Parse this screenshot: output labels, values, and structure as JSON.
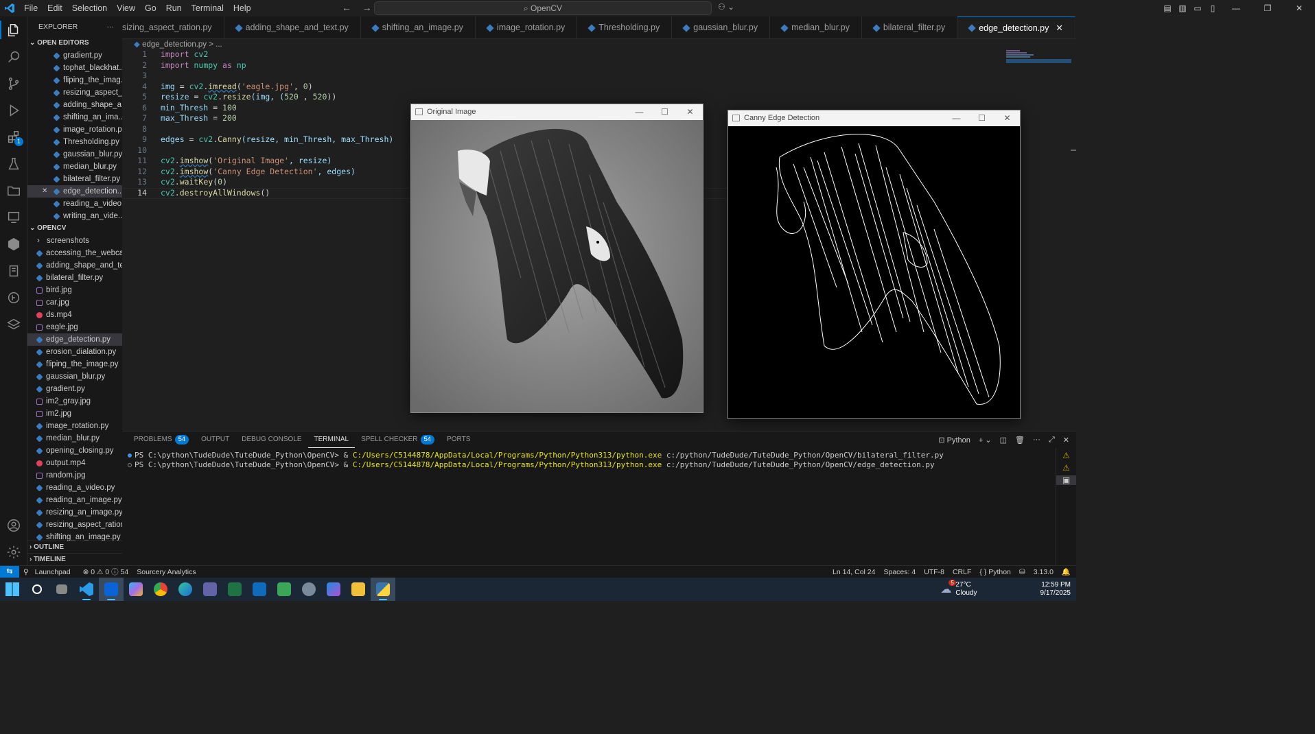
{
  "menu": [
    "File",
    "Edit",
    "Selection",
    "View",
    "Go",
    "Run",
    "Terminal",
    "Help"
  ],
  "search": "OpenCV",
  "explorer": {
    "title": "EXPLORER",
    "open_editors": "OPEN EDITORS",
    "folder": "OPENCV",
    "outline": "OUTLINE",
    "timeline": "TIMELINE",
    "badge": "1"
  },
  "open_editors": [
    "gradient.py",
    "tophat_blackhat...",
    "fliping_the_imag...",
    "resizing_aspect_...",
    "adding_shape_a...",
    "shifting_an_ima...",
    "image_rotation.py",
    "Thresholding.py",
    "gaussian_blur.py",
    "median_blur.py",
    "bilateral_filter.py",
    "edge_detection....",
    "reading_a_video...",
    "writing_an_vide..."
  ],
  "files": [
    {
      "name": "screenshots",
      "type": "folder"
    },
    {
      "name": "accessing_the_webca...",
      "type": "py"
    },
    {
      "name": "adding_shape_and_te...",
      "type": "py"
    },
    {
      "name": "bilateral_filter.py",
      "type": "py"
    },
    {
      "name": "bird.jpg",
      "type": "img"
    },
    {
      "name": "car.jpg",
      "type": "img"
    },
    {
      "name": "ds.mp4",
      "type": "mp4"
    },
    {
      "name": "eagle.jpg",
      "type": "img"
    },
    {
      "name": "edge_detection.py",
      "type": "py"
    },
    {
      "name": "erosion_dialation.py",
      "type": "py"
    },
    {
      "name": "fliping_the_image.py",
      "type": "py"
    },
    {
      "name": "gaussian_blur.py",
      "type": "py"
    },
    {
      "name": "gradient.py",
      "type": "py"
    },
    {
      "name": "im2_gray.jpg",
      "type": "img"
    },
    {
      "name": "im2.jpg",
      "type": "img"
    },
    {
      "name": "image_rotation.py",
      "type": "py"
    },
    {
      "name": "median_blur.py",
      "type": "py"
    },
    {
      "name": "opening_closing.py",
      "type": "py"
    },
    {
      "name": "output.mp4",
      "type": "mp4"
    },
    {
      "name": "random.jpg",
      "type": "img"
    },
    {
      "name": "reading_a_video.py",
      "type": "py"
    },
    {
      "name": "reading_an_image.py",
      "type": "py"
    },
    {
      "name": "resizing_an_image.py",
      "type": "py"
    },
    {
      "name": "resizing_aspect_ration...",
      "type": "py"
    },
    {
      "name": "shifting_an_image.py",
      "type": "py"
    }
  ],
  "tabs": [
    "sizing_aspect_ration.py",
    "adding_shape_and_text.py",
    "shifting_an_image.py",
    "image_rotation.py",
    "Thresholding.py",
    "gaussian_blur.py",
    "median_blur.py",
    "bilateral_filter.py",
    "edge_detection.py"
  ],
  "breadcrumb": "edge_detection.py > ...",
  "code_lines": [
    "1",
    "2",
    "3",
    "4",
    "5",
    "6",
    "7",
    "8",
    "9",
    "10",
    "11",
    "12",
    "13",
    "14"
  ],
  "code": {
    "l1a": "import",
    "l1b": " cv2",
    "l2a": "import",
    "l2b": " numpy ",
    "l2c": "as",
    "l2d": " np",
    "l4a": "img",
    "l4b": " = ",
    "l4c": "cv2",
    "l4d": ".",
    "l4e": "imread",
    "l4f": "(",
    "l4g": "'eagle.jpg'",
    "l4h": ", ",
    "l4i": "0",
    "l4j": ")",
    "l5a": "resize",
    "l5b": " = ",
    "l5c": "cv2",
    "l5d": ".",
    "l5e": "resize",
    "l5f": "(img, (",
    "l5g": "520",
    "l5h": " , ",
    "l5i": "520",
    "l5j": "))",
    "l6a": "min_Thresh",
    "l6b": " = ",
    "l6c": "100",
    "l7a": "max_Thresh",
    "l7b": " = ",
    "l7c": "200",
    "l9a": "edges",
    "l9b": " = ",
    "l9c": "cv2",
    "l9d": ".",
    "l9e": "Canny",
    "l9f": "(resize, min_Thresh, max_Thresh)",
    "l11a": "cv2",
    "l11b": ".",
    "l11c": "imshow",
    "l11d": "(",
    "l11e": "'Original Image'",
    "l11f": ", resize)",
    "l12a": "cv2",
    "l12b": ".",
    "l12c": "imshow",
    "l12d": "(",
    "l12e": "'Canny Edge Detection'",
    "l12f": ", edges)",
    "l13a": "cv2",
    "l13b": ".",
    "l13c": "waitKey",
    "l13d": "(",
    "l13e": "0",
    "l13f": ")",
    "l14a": "cv2",
    "l14b": ".",
    "l14c": "destroyAllWindows",
    "l14d": "()"
  },
  "win1": {
    "title": "Original Image"
  },
  "win2": {
    "title": "Canny Edge Detection"
  },
  "panel": {
    "problems": "PROBLEMS",
    "problems_count": "54",
    "output": "OUTPUT",
    "debug": "DEBUG CONSOLE",
    "terminal": "TERMINAL",
    "spell": "SPELL CHECKER",
    "spell_count": "54",
    "ports": "PORTS",
    "shell": "Python"
  },
  "terminal": [
    {
      "prompt": "PS C:\\python\\TudeDude\\TuteDude_Python\\OpenCV> & ",
      "exe": "C:/Users/C5144878/AppData/Local/Programs/Python/Python313/python.exe",
      "arg": " c:/python/TudeDude/TuteDude_Python/OpenCV/bilateral_filter.py"
    },
    {
      "prompt": "PS C:\\python\\TudeDude\\TuteDude_Python\\OpenCV> & ",
      "exe": "C:/Users/C5144878/AppData/Local/Programs/Python/Python313/python.exe",
      "arg": " c:/python/TudeDude/TuteDude_Python/OpenCV/edge_detection.py"
    }
  ],
  "status": {
    "launchpad": "Launchpad",
    "problems": "⊗ 0 ⚠ 0 ⓘ 54",
    "sourcery": "Sourcery Analytics",
    "pos": "Ln 14, Col 24",
    "spaces": "Spaces: 4",
    "enc": "UTF-8",
    "eol": "CRLF",
    "lang": "{ } Python",
    "ver": "3.13.0"
  },
  "taskbar": {
    "temp": "27°C",
    "weather": "Cloudy",
    "time": "12:59 PM",
    "date": "9/17/2025",
    "notif": "5"
  },
  "colors": {
    "accent": "#0078d4",
    "bg": "#1f1f1f",
    "sidebar": "#181818"
  }
}
